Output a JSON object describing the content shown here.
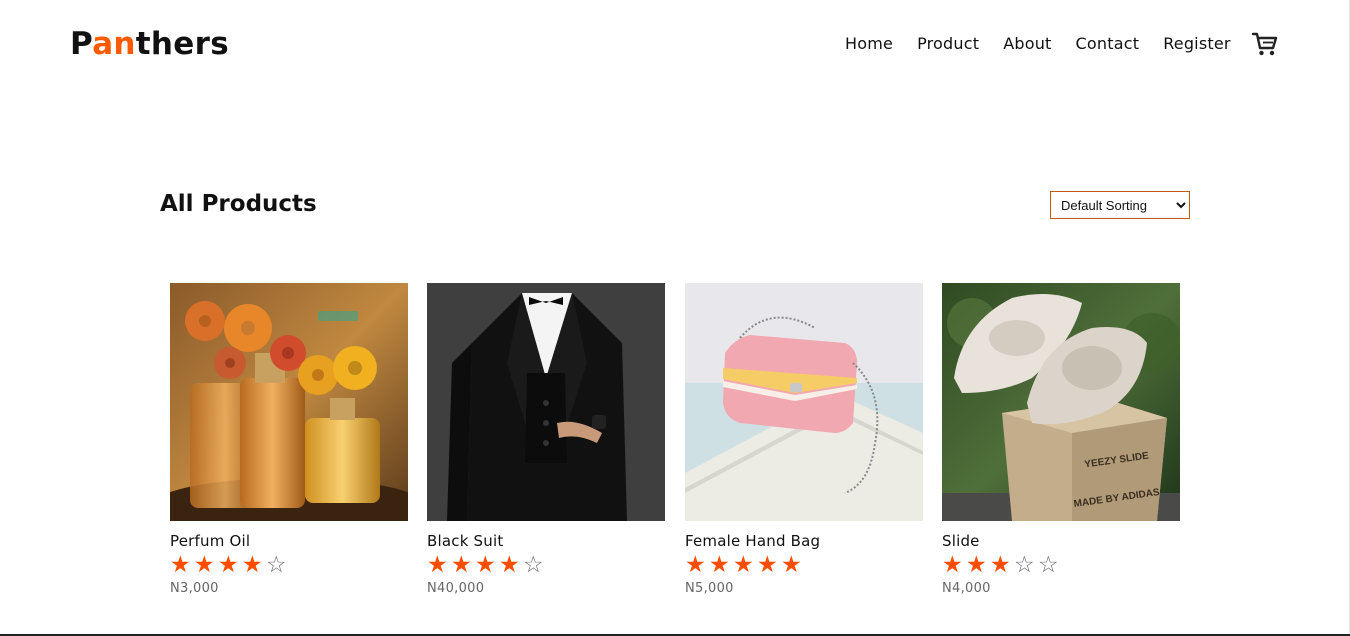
{
  "header": {
    "logo_prefix": "P",
    "logo_accent": "an",
    "logo_suffix": "thers",
    "nav": [
      "Home",
      "Product",
      "About",
      "Contact",
      "Register"
    ],
    "cart_icon": "shopping-cart-icon"
  },
  "section": {
    "title": "All Products",
    "sort_selected": "Default Sorting"
  },
  "colors": {
    "accent": "#ff5a00",
    "star": "#ff4d00"
  },
  "products": [
    {
      "name": "Perfum Oil",
      "rating": 4,
      "max_rating": 5,
      "price": "N3,000"
    },
    {
      "name": "Black Suit",
      "rating": 4,
      "max_rating": 5,
      "price": "N40,000"
    },
    {
      "name": "Female Hand Bag",
      "rating": 5,
      "max_rating": 5,
      "price": "N5,000"
    },
    {
      "name": "Slide",
      "rating": 3,
      "max_rating": 5,
      "price": "N4,000"
    }
  ]
}
